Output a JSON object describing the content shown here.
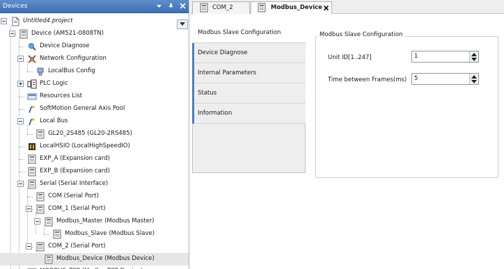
{
  "devices_panel": {
    "title": "Devices",
    "tree": [
      {
        "label": "Untitled4.project",
        "icon": "project-icon"
      },
      {
        "label": "Device (AM521-0808TN)",
        "icon": "device-icon"
      },
      {
        "label": "Device Diagnose",
        "icon": "diagnose-icon"
      },
      {
        "label": "Network Configuration",
        "icon": "network-config-icon"
      },
      {
        "label": "LocalBus Config",
        "icon": "localbus-config-icon"
      },
      {
        "label": "PLC Logic",
        "icon": "plc-logic-icon"
      },
      {
        "label": "Resources List",
        "icon": "resources-list-icon"
      },
      {
        "label": "SoftMotion General Axis Pool",
        "icon": "axis-pool-icon"
      },
      {
        "label": "Local Bus",
        "icon": "local-bus-icon"
      },
      {
        "label": "GL20_2S485 (GL20-2RS485)",
        "icon": "module-icon"
      },
      {
        "label": "LocalHSIO (LocalHighSpeedIO)",
        "icon": "hsio-icon"
      },
      {
        "label": "EXP_A (Expansion card)",
        "icon": "module-icon"
      },
      {
        "label": "EXP_B (Expansion card)",
        "icon": "module-icon"
      },
      {
        "label": "Serial (Serial Interface)",
        "icon": "module-icon"
      },
      {
        "label": "COM (Serial Port)",
        "icon": "module-icon"
      },
      {
        "label": "COM_1 (Serial Port)",
        "icon": "module-icon"
      },
      {
        "label": "Modbus_Master (Modbus Master)",
        "icon": "module-icon"
      },
      {
        "label": "Modbus_Slave (Modbus Slave)",
        "icon": "module-icon"
      },
      {
        "label": "COM_2 (Serial Port)",
        "icon": "module-icon"
      },
      {
        "label": "Modbus_Device (Modbus Device)",
        "icon": "module-icon"
      },
      {
        "label": "MODBUS_TCP (ModbusTCP Device)",
        "icon": "tcp-device-icon"
      }
    ]
  },
  "editor": {
    "tabs": [
      {
        "label": "COM_2"
      },
      {
        "label": "Modbus_Device"
      }
    ],
    "side_tabs": [
      {
        "label": "Modbus Slave Configuration"
      },
      {
        "label": "Device Diagnose"
      },
      {
        "label": "Internal Parameters"
      },
      {
        "label": "Status"
      },
      {
        "label": "Information"
      }
    ],
    "config": {
      "group_title": "Modbus Slave Configuration",
      "unit_id": {
        "label": "Unit ID[1..247]",
        "value": "1"
      },
      "frame_time": {
        "label": "Time between Frames(ms)",
        "value": "5"
      }
    }
  },
  "colors": {
    "panel_header": "#3c6fb4",
    "selected_row": "#e6e6e6",
    "active_tab_accent": "#4a7fc4"
  }
}
